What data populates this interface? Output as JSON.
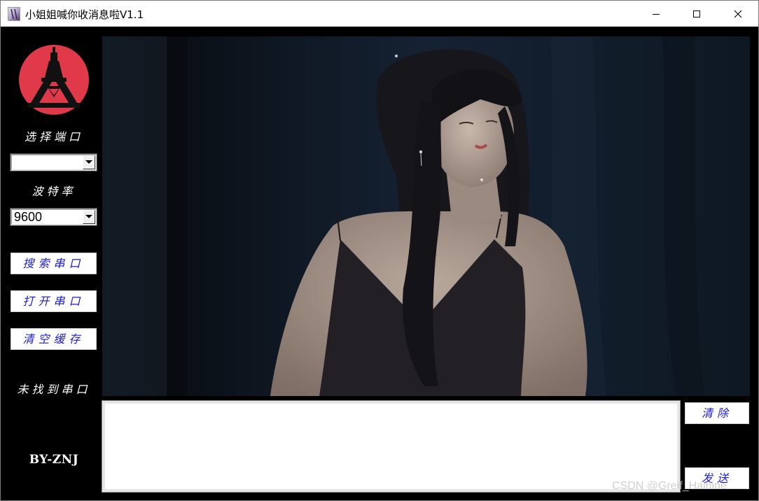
{
  "window": {
    "title": "小姐姐喊你收消息啦V1.1"
  },
  "sidebar": {
    "port_label": "选择端口",
    "port_value": "",
    "baud_label": "波特率",
    "baud_value": "9600",
    "search_button": "搜索串口",
    "open_button": "打开串口",
    "clear_cache_button": "清空缓存",
    "status_text": "未找到串口",
    "author": "BY-ZNJ"
  },
  "main": {
    "display_content": "portrait-photo",
    "send_input_value": "",
    "clear_button": "清除",
    "send_button": "发送"
  },
  "watermark": "CSDN @Greif_Hairline",
  "colors": {
    "background": "#000000",
    "button_text": "#1a1ad4",
    "logo_red": "#e0394a",
    "label_text": "#ffffff"
  },
  "icons": {
    "app": "app-icon",
    "logo": "eiffel-tower-logo",
    "dropdown": "chevron-down-icon"
  }
}
